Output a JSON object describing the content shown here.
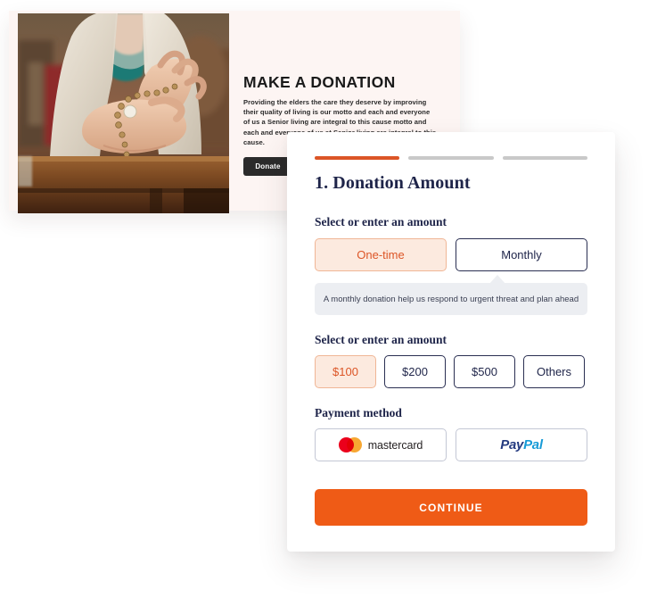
{
  "promo": {
    "title": "MAKE A DONATION",
    "body": "Providing the elders the care they deserve by improving their quality of living is our motto and each and everyone of us a Senior living are integral to this cause motto and each and everyone of us at Senior living are integral to this cause.",
    "donate_label": "Donate",
    "photo_alt": "elderly-hands-holding-rosary-photo",
    "background_color": "#FDF5F3"
  },
  "donation": {
    "step_title": "1. Donation Amount",
    "steps": [
      {
        "label": "step-1",
        "active": true
      },
      {
        "label": "step-2",
        "active": false
      },
      {
        "label": "step-3",
        "active": false
      }
    ],
    "frequency": {
      "label": "Select or enter an amount",
      "options": [
        {
          "label": "One-time",
          "selected": true
        },
        {
          "label": "Monthly",
          "selected": false
        }
      ],
      "tooltip": "A monthly donation help us respond to urgent threat and plan ahead"
    },
    "amount": {
      "label": "Select or enter an amount",
      "options": [
        {
          "label": "$100",
          "selected": true
        },
        {
          "label": "$200",
          "selected": false
        },
        {
          "label": "$500",
          "selected": false
        },
        {
          "label": "Others",
          "selected": false
        }
      ]
    },
    "payment": {
      "label": "Payment method",
      "options": [
        {
          "label": "mastercard",
          "icon": "mastercard-logo",
          "selected": false
        },
        {
          "label": "PayPal",
          "icon": "paypal-logo",
          "pay": "Pay",
          "pal": "Pal",
          "selected": false
        }
      ]
    },
    "continue_label": "CONTINUE"
  },
  "colors": {
    "accent_orange": "#EF5B16",
    "progress_orange": "#DC5526",
    "navy": "#1E2449",
    "selected_fill": "#FCEADF",
    "tooltip_bg": "#ECEEF2",
    "mastercard_red": "#EB001B",
    "mastercard_yellow": "#F79E1B",
    "paypal_dark": "#253B80",
    "paypal_light": "#179BD7"
  }
}
